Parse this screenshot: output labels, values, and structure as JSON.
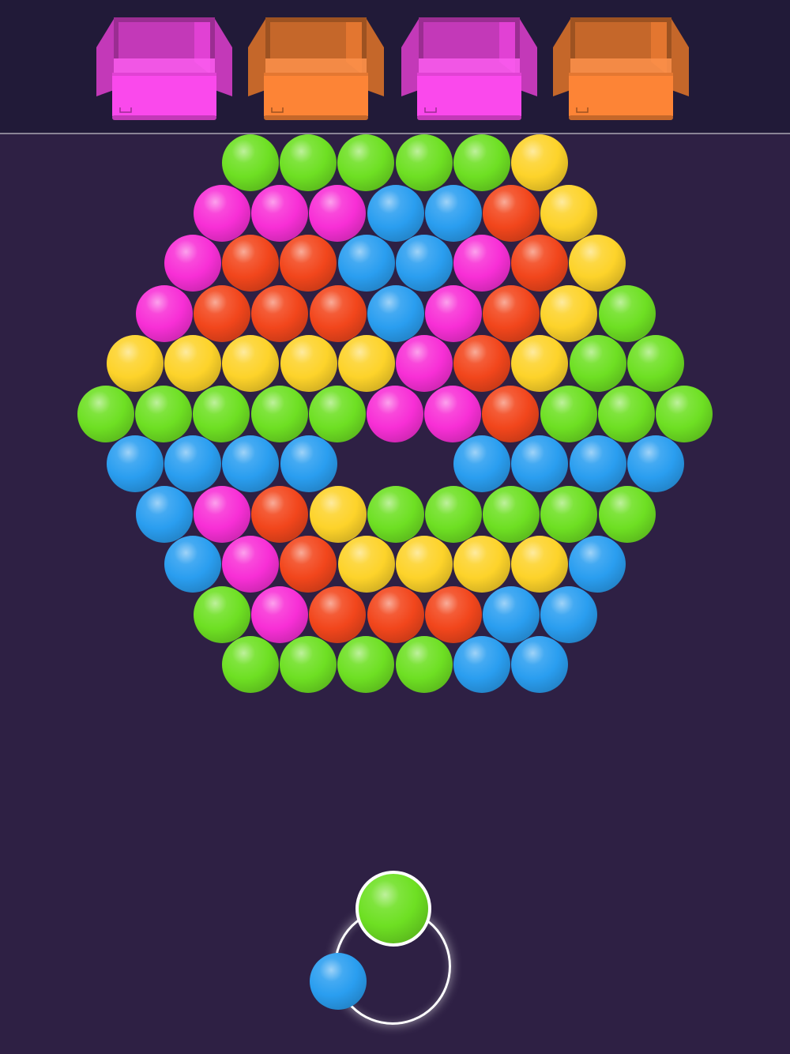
{
  "colors": {
    "background": "#2e2044",
    "top_bar": "#211a38",
    "green": "#6ee023",
    "yellow": "#fdd32a",
    "magenta": "#f82fd6",
    "orange": "#f2461c",
    "blue": "#2a9ef0",
    "box_magenta": "#fa49ec",
    "box_orange": "#fd8436"
  },
  "collection_boxes": [
    {
      "color": "magenta"
    },
    {
      "color": "orange"
    },
    {
      "color": "magenta"
    },
    {
      "color": "orange"
    }
  ],
  "board_rows": [
    [
      "green",
      "green",
      "green",
      "green",
      "green",
      "yellow"
    ],
    [
      "magenta",
      "magenta",
      "magenta",
      "blue",
      "blue",
      "orange",
      "yellow"
    ],
    [
      "magenta",
      "orange",
      "orange",
      "blue",
      "blue",
      "magenta",
      "orange",
      "yellow"
    ],
    [
      "magenta",
      "orange",
      "orange",
      "orange",
      "blue",
      "magenta",
      "orange",
      "yellow",
      "green"
    ],
    [
      "yellow",
      "yellow",
      "yellow",
      "yellow",
      "yellow",
      "magenta",
      "orange",
      "yellow",
      "green",
      "green"
    ],
    [
      "green",
      "green",
      "green",
      "green",
      "green",
      "magenta",
      "magenta",
      "orange",
      "green",
      "green",
      "green"
    ],
    [
      "blue",
      "blue",
      "blue",
      "blue",
      null,
      null,
      "blue",
      "blue",
      "blue",
      "blue"
    ],
    [
      "blue",
      "magenta",
      "orange",
      "yellow",
      "green",
      "green",
      "green",
      "green",
      "green"
    ],
    [
      "blue",
      "magenta",
      "orange",
      "yellow",
      "yellow",
      "yellow",
      "yellow",
      "blue"
    ],
    [
      "green",
      "magenta",
      "orange",
      "orange",
      "orange",
      "blue",
      "blue"
    ],
    [
      "green",
      "green",
      "green",
      "green",
      "blue",
      "blue"
    ]
  ],
  "shooter": {
    "current_ball": "green",
    "next_ball": "blue"
  }
}
